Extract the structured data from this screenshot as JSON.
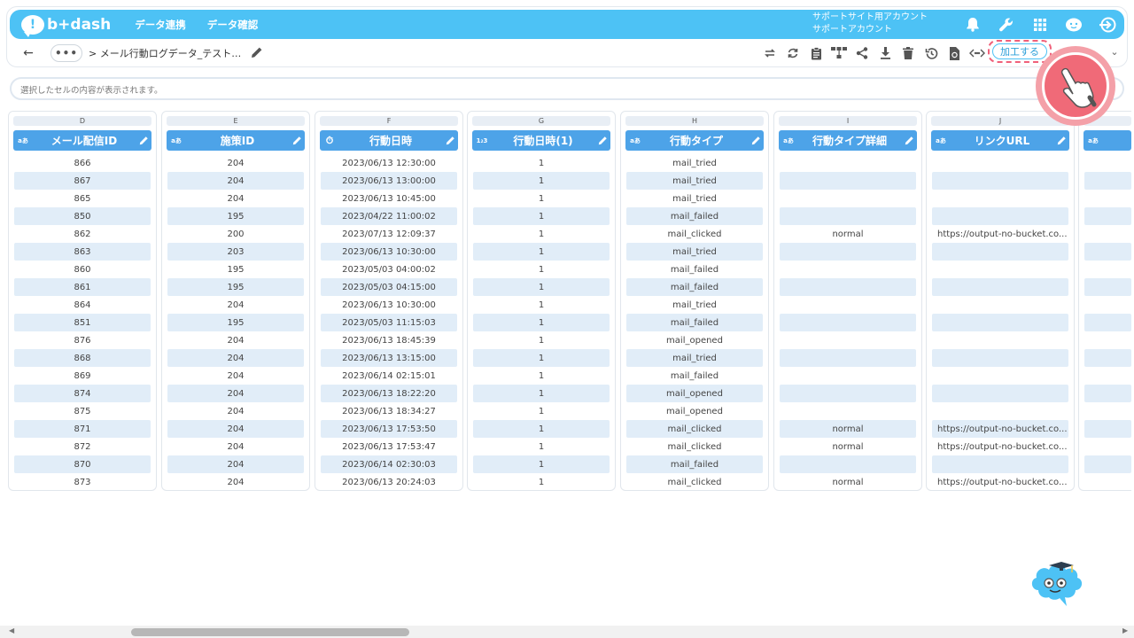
{
  "header": {
    "logo_text": "b+dash",
    "nav": [
      "データ連携",
      "データ確認"
    ],
    "account_line1": "サポートサイト用アカウント",
    "account_line2": "サポートアカウント"
  },
  "subbar": {
    "more": "•••",
    "breadcrumb": "> メール行動ログデータ_テスト…",
    "process_label": "加工する"
  },
  "cell_box": {
    "placeholder": "選択したセルの内容が表示されます。"
  },
  "columns": [
    {
      "letter": "D",
      "type": "aあ",
      "name": "メール配信ID",
      "values": [
        "866",
        "867",
        "865",
        "850",
        "862",
        "863",
        "860",
        "861",
        "864",
        "851",
        "876",
        "868",
        "869",
        "874",
        "875",
        "871",
        "872",
        "870",
        "873"
      ]
    },
    {
      "letter": "E",
      "type": "aあ",
      "name": "施策ID",
      "values": [
        "204",
        "204",
        "204",
        "195",
        "200",
        "203",
        "195",
        "195",
        "204",
        "195",
        "204",
        "204",
        "204",
        "204",
        "204",
        "204",
        "204",
        "204",
        "204"
      ]
    },
    {
      "letter": "F",
      "type": "⏱",
      "name": "行動日時",
      "values": [
        "2023/06/13 12:30:00",
        "2023/06/13 13:00:00",
        "2023/06/13 10:45:00",
        "2023/04/22 11:00:02",
        "2023/07/13 12:09:37",
        "2023/06/13 10:30:00",
        "2023/05/03 04:00:02",
        "2023/05/03 04:15:00",
        "2023/06/13 10:30:00",
        "2023/05/03 11:15:03",
        "2023/06/13 18:45:39",
        "2023/06/13 13:15:00",
        "2023/06/14 02:15:01",
        "2023/06/13 18:22:20",
        "2023/06/13 18:34:27",
        "2023/06/13 17:53:50",
        "2023/06/13 17:53:47",
        "2023/06/14 02:30:03",
        "2023/06/13 20:24:03"
      ]
    },
    {
      "letter": "G",
      "type": "1₂3",
      "name": "行動日時(1)",
      "values": [
        "1",
        "1",
        "1",
        "1",
        "1",
        "1",
        "1",
        "1",
        "1",
        "1",
        "1",
        "1",
        "1",
        "1",
        "1",
        "1",
        "1",
        "1",
        "1"
      ]
    },
    {
      "letter": "H",
      "type": "aあ",
      "name": "行動タイプ",
      "values": [
        "mail_tried",
        "mail_tried",
        "mail_tried",
        "mail_failed",
        "mail_clicked",
        "mail_tried",
        "mail_failed",
        "mail_failed",
        "mail_tried",
        "mail_failed",
        "mail_opened",
        "mail_tried",
        "mail_failed",
        "mail_opened",
        "mail_opened",
        "mail_clicked",
        "mail_clicked",
        "mail_failed",
        "mail_clicked"
      ]
    },
    {
      "letter": "I",
      "type": "aあ",
      "name": "行動タイプ詳細",
      "values": [
        "",
        "",
        "",
        "",
        "normal",
        "",
        "",
        "",
        "",
        "",
        "",
        "",
        "",
        "",
        "",
        "normal",
        "normal",
        "",
        "normal"
      ]
    },
    {
      "letter": "J",
      "type": "aあ",
      "name": "リンクURL",
      "values": [
        "",
        "",
        "",
        "",
        "https://output-no-bucket.co...",
        "",
        "",
        "",
        "",
        "",
        "",
        "",
        "",
        "",
        "",
        "https://output-no-bucket.co...",
        "https://output-no-bucket.co...",
        "",
        "https://output-no-bucket.co..."
      ]
    }
  ],
  "partial_column": {
    "type": "aあ"
  }
}
